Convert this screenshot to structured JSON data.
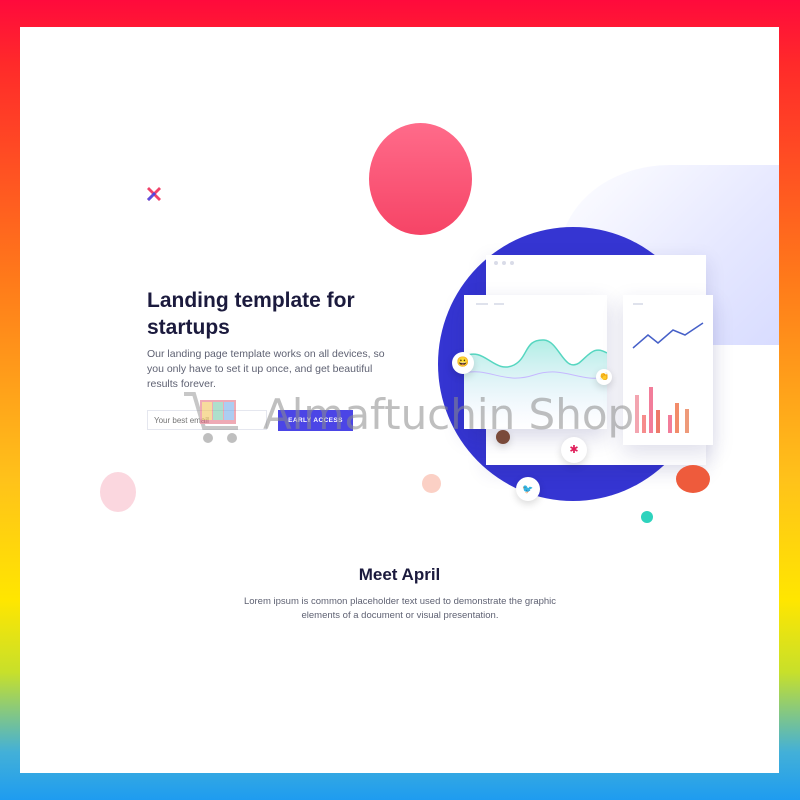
{
  "hero": {
    "headline": "Landing template for startups",
    "subtext": "Our landing page template works on all devices, so you only have to set it up once, and get beautiful results forever.",
    "email_placeholder": "Your best email",
    "cta_label": "EARLY ACCESS",
    "logo_icon": "x-logo-icon"
  },
  "section": {
    "title": "Meet April",
    "body": "Lorem ipsum is common placeholder text used to demonstrate the graphic elements of a document or visual presentation."
  },
  "watermark": {
    "text": "Almaftuchin Shop",
    "icon": "shopping-cart-icon"
  },
  "colors": {
    "accent": "#4b45e6",
    "headline": "#1b1a3d",
    "circle": "#3535d2",
    "pink": "#f64466",
    "teal": "#2ed3bd"
  }
}
